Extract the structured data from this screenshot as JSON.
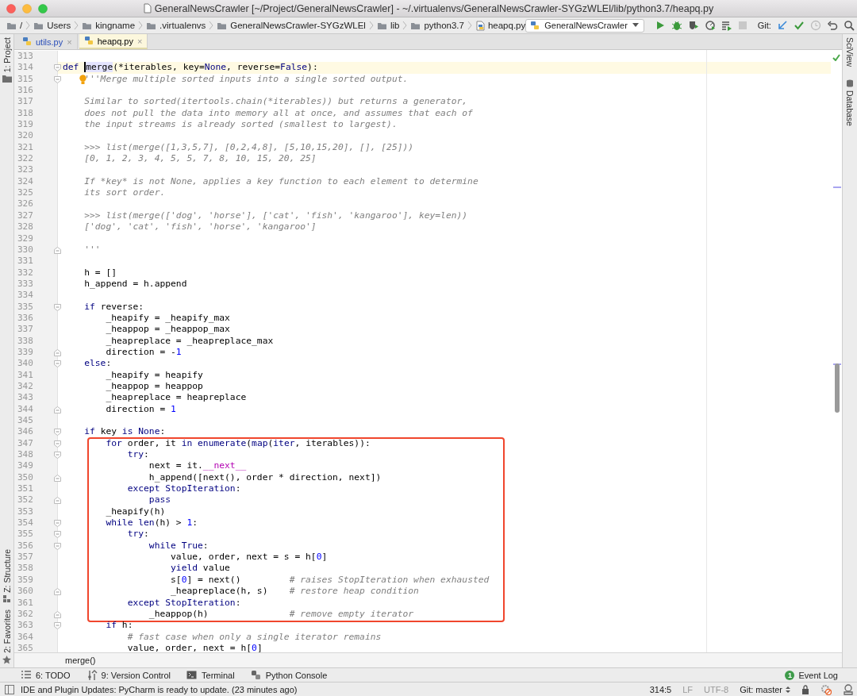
{
  "window": {
    "title": "GeneralNewsCrawler [~/Project/GeneralNewsCrawler] - ~/.virtualenvs/GeneralNewsCrawler-SYGzWLEl/lib/python3.7/heapq.py"
  },
  "navbar": {
    "path": [
      {
        "label": "/",
        "kind": "folder"
      },
      {
        "label": "Users",
        "kind": "folder"
      },
      {
        "label": "kingname",
        "kind": "folder"
      },
      {
        "label": ".virtualenvs",
        "kind": "folder"
      },
      {
        "label": "GeneralNewsCrawler-SYGzWLEl",
        "kind": "folder"
      },
      {
        "label": "lib",
        "kind": "folder"
      },
      {
        "label": "python3.7",
        "kind": "folder"
      },
      {
        "label": "heapq.py",
        "kind": "file"
      }
    ],
    "run_config": "GeneralNewsCrawler",
    "git_label": "Git:"
  },
  "left_tool_strip": {
    "top": [
      {
        "label": "1: Project",
        "kind": "project"
      }
    ],
    "bottom": [
      {
        "label": "Z: Structure",
        "kind": "structure"
      },
      {
        "label": "2: Favorites",
        "kind": "favorites"
      }
    ]
  },
  "right_tool_strip": [
    {
      "label": "SciView",
      "kind": "sciview"
    },
    {
      "label": "Database",
      "kind": "database"
    }
  ],
  "tabs": [
    {
      "label": "utils.py",
      "close": "×",
      "selected": false,
      "kind": "modified"
    },
    {
      "label": "heapq.py",
      "close": "×",
      "selected": true,
      "kind": "unmodified"
    }
  ],
  "editor": {
    "sections": [
      {
        "kind": "plain",
        "lines": [
          {
            "number": "313",
            "current": false,
            "bulb": false
          },
          {
            "number": "314",
            "current": true,
            "bulb": false,
            "fold": {
              "kind": "start"
            },
            "segments": [
              {
                "kind": "kw",
                "text": "def "
              },
              {
                "kind": "caret_word",
                "text": "merge"
              },
              {
                "kind": "plain",
                "text": "(*iterables, key="
              },
              {
                "kind": "kw",
                "text": "None"
              },
              {
                "kind": "plain",
                "text": ", reverse="
              },
              {
                "kind": "kw",
                "text": "False"
              },
              {
                "kind": "plain",
                "text": "):"
              }
            ]
          },
          {
            "number": "315",
            "current": false,
            "bulb": true,
            "fold": {
              "kind": "start"
            },
            "segments": [
              {
                "kind": "doc",
                "text": "    '''Merge multiple sorted inputs into a single sorted output."
              }
            ]
          },
          {
            "number": "316",
            "current": false,
            "bulb": false
          },
          {
            "number": "317",
            "current": false,
            "bulb": false,
            "segments": [
              {
                "kind": "doc",
                "text": "    Similar to sorted(itertools.chain(*iterables)) but returns a generator,"
              }
            ]
          },
          {
            "number": "318",
            "current": false,
            "bulb": false,
            "segments": [
              {
                "kind": "doc",
                "text": "    does not pull the data into memory all at once, and assumes that each of"
              }
            ]
          },
          {
            "number": "319",
            "current": false,
            "bulb": false,
            "segments": [
              {
                "kind": "doc",
                "text": "    the input streams is already sorted (smallest to largest)."
              }
            ]
          },
          {
            "number": "320",
            "current": false,
            "bulb": false
          },
          {
            "number": "321",
            "current": false,
            "bulb": false,
            "segments": [
              {
                "kind": "doc",
                "text": "    >>> list(merge([1,3,5,7], [0,2,4,8], [5,10,15,20], [], [25]))"
              }
            ]
          },
          {
            "number": "322",
            "current": false,
            "bulb": false,
            "segments": [
              {
                "kind": "doc",
                "text": "    [0, 1, 2, 3, 4, 5, 5, 7, 8, 10, 15, 20, 25]"
              }
            ]
          },
          {
            "number": "323",
            "current": false,
            "bulb": false
          },
          {
            "number": "324",
            "current": false,
            "bulb": false,
            "segments": [
              {
                "kind": "doc",
                "text": "    If *key* is not None, applies a key function to each element to determine"
              }
            ]
          },
          {
            "number": "325",
            "current": false,
            "bulb": false,
            "segments": [
              {
                "kind": "doc",
                "text": "    its sort order."
              }
            ]
          },
          {
            "number": "326",
            "current": false,
            "bulb": false
          },
          {
            "number": "327",
            "current": false,
            "bulb": false,
            "segments": [
              {
                "kind": "doc",
                "text": "    >>> list(merge(['dog', 'horse'], ['cat', 'fish', 'kangaroo'], key=len))"
              }
            ]
          },
          {
            "number": "328",
            "current": false,
            "bulb": false,
            "segments": [
              {
                "kind": "doc",
                "text": "    ['dog', 'cat', 'fish', 'horse', 'kangaroo']"
              }
            ]
          },
          {
            "number": "329",
            "current": false,
            "bulb": false
          },
          {
            "number": "330",
            "current": false,
            "bulb": false,
            "fold": {
              "kind": "end"
            },
            "segments": [
              {
                "kind": "doc",
                "text": "    '''"
              }
            ]
          },
          {
            "number": "331",
            "current": false,
            "bulb": false
          },
          {
            "number": "332",
            "current": false,
            "bulb": false,
            "segments": [
              {
                "kind": "plain",
                "text": "    h = []"
              }
            ]
          },
          {
            "number": "333",
            "current": false,
            "bulb": false,
            "segments": [
              {
                "kind": "plain",
                "text": "    h_append = h.append"
              }
            ]
          },
          {
            "number": "334",
            "current": false,
            "bulb": false
          },
          {
            "number": "335",
            "current": false,
            "bulb": false,
            "fold": {
              "kind": "start"
            },
            "segments": [
              {
                "kind": "kw",
                "text": "    if"
              },
              {
                "kind": "plain",
                "text": " reverse:"
              }
            ]
          },
          {
            "number": "336",
            "current": false,
            "bulb": false,
            "segments": [
              {
                "kind": "plain",
                "text": "        _heapify = _heapify_max"
              }
            ]
          },
          {
            "number": "337",
            "current": false,
            "bulb": false,
            "segments": [
              {
                "kind": "plain",
                "text": "        _heappop = _heappop_max"
              }
            ]
          },
          {
            "number": "338",
            "current": false,
            "bulb": false,
            "segments": [
              {
                "kind": "plain",
                "text": "        _heapreplace = _heapreplace_max"
              }
            ]
          },
          {
            "number": "339",
            "current": false,
            "bulb": false,
            "fold": {
              "kind": "end"
            },
            "segments": [
              {
                "kind": "plain",
                "text": "        direction = -"
              },
              {
                "kind": "num",
                "text": "1"
              }
            ]
          },
          {
            "number": "340",
            "current": false,
            "bulb": false,
            "fold": {
              "kind": "start"
            },
            "segments": [
              {
                "kind": "kw",
                "text": "    else"
              },
              {
                "kind": "plain",
                "text": ":"
              }
            ]
          },
          {
            "number": "341",
            "current": false,
            "bulb": false,
            "segments": [
              {
                "kind": "plain",
                "text": "        _heapify = heapify"
              }
            ]
          },
          {
            "number": "342",
            "current": false,
            "bulb": false,
            "segments": [
              {
                "kind": "plain",
                "text": "        _heappop = heappop"
              }
            ]
          },
          {
            "number": "343",
            "current": false,
            "bulb": false,
            "segments": [
              {
                "kind": "plain",
                "text": "        _heapreplace = heapreplace"
              }
            ]
          },
          {
            "number": "344",
            "current": false,
            "bulb": false,
            "fold": {
              "kind": "end"
            },
            "segments": [
              {
                "kind": "plain",
                "text": "        direction = "
              },
              {
                "kind": "num",
                "text": "1"
              }
            ]
          },
          {
            "number": "345",
            "current": false,
            "bulb": false
          },
          {
            "number": "346",
            "current": false,
            "bulb": false,
            "fold": {
              "kind": "start"
            },
            "segments": [
              {
                "kind": "kw",
                "text": "    if"
              },
              {
                "kind": "plain",
                "text": " key "
              },
              {
                "kind": "kw",
                "text": "is None"
              },
              {
                "kind": "plain",
                "text": ":"
              }
            ]
          }
        ]
      },
      {
        "kind": "boxed",
        "lines": [
          {
            "number": "347",
            "current": false,
            "bulb": false,
            "fold": {
              "kind": "start"
            },
            "segments": [
              {
                "kind": "kw",
                "text": "        for"
              },
              {
                "kind": "plain",
                "text": " order, it "
              },
              {
                "kind": "kw",
                "text": "in enumerate"
              },
              {
                "kind": "plain",
                "text": "("
              },
              {
                "kind": "kw",
                "text": "map"
              },
              {
                "kind": "plain",
                "text": "("
              },
              {
                "kind": "kw",
                "text": "iter"
              },
              {
                "kind": "plain",
                "text": ", iterables)):"
              }
            ]
          },
          {
            "number": "348",
            "current": false,
            "bulb": false,
            "fold": {
              "kind": "start"
            },
            "segments": [
              {
                "kind": "kw",
                "text": "            try"
              },
              {
                "kind": "plain",
                "text": ":"
              }
            ]
          },
          {
            "number": "349",
            "current": false,
            "bulb": false,
            "segments": [
              {
                "kind": "plain",
                "text": "                next = it."
              },
              {
                "kind": "magic",
                "text": "__next__"
              }
            ]
          },
          {
            "number": "350",
            "current": false,
            "bulb": false,
            "fold": {
              "kind": "end"
            },
            "segments": [
              {
                "kind": "plain",
                "text": "                h_append([next(), order * direction, next])"
              }
            ]
          },
          {
            "number": "351",
            "current": false,
            "bulb": false,
            "segments": [
              {
                "kind": "kw",
                "text": "            except StopIteration"
              },
              {
                "kind": "plain",
                "text": ":"
              }
            ]
          },
          {
            "number": "352",
            "current": false,
            "bulb": false,
            "fold": {
              "kind": "end"
            },
            "segments": [
              {
                "kind": "kw",
                "text": "                pass"
              }
            ]
          },
          {
            "number": "353",
            "current": false,
            "bulb": false,
            "segments": [
              {
                "kind": "plain",
                "text": "        _heapify(h)"
              }
            ]
          },
          {
            "number": "354",
            "current": false,
            "bulb": false,
            "fold": {
              "kind": "start"
            },
            "segments": [
              {
                "kind": "kw",
                "text": "        while len"
              },
              {
                "kind": "plain",
                "text": "(h) > "
              },
              {
                "kind": "num",
                "text": "1"
              },
              {
                "kind": "plain",
                "text": ":"
              }
            ]
          },
          {
            "number": "355",
            "current": false,
            "bulb": false,
            "fold": {
              "kind": "start"
            },
            "segments": [
              {
                "kind": "kw",
                "text": "            try"
              },
              {
                "kind": "plain",
                "text": ":"
              }
            ]
          },
          {
            "number": "356",
            "current": false,
            "bulb": false,
            "fold": {
              "kind": "start"
            },
            "segments": [
              {
                "kind": "kw",
                "text": "                while True"
              },
              {
                "kind": "plain",
                "text": ":"
              }
            ]
          },
          {
            "number": "357",
            "current": false,
            "bulb": false,
            "segments": [
              {
                "kind": "plain",
                "text": "                    value, order, next = s = h["
              },
              {
                "kind": "num",
                "text": "0"
              },
              {
                "kind": "plain",
                "text": "]"
              }
            ]
          },
          {
            "number": "358",
            "current": false,
            "bulb": false,
            "segments": [
              {
                "kind": "kw",
                "text": "                    yield"
              },
              {
                "kind": "plain",
                "text": " value"
              }
            ]
          },
          {
            "number": "359",
            "current": false,
            "bulb": false,
            "segments": [
              {
                "kind": "plain",
                "text": "                    s["
              },
              {
                "kind": "num",
                "text": "0"
              },
              {
                "kind": "plain",
                "text": "] = next()         "
              },
              {
                "kind": "comment",
                "text": "# raises StopIteration when exhausted"
              }
            ]
          },
          {
            "number": "360",
            "current": false,
            "bulb": false,
            "fold": {
              "kind": "end"
            },
            "segments": [
              {
                "kind": "plain",
                "text": "                    _heapreplace(h, s)    "
              },
              {
                "kind": "comment",
                "text": "# restore heap condition"
              }
            ]
          },
          {
            "number": "361",
            "current": false,
            "bulb": false,
            "segments": [
              {
                "kind": "kw",
                "text": "            except StopIteration"
              },
              {
                "kind": "plain",
                "text": ":"
              }
            ]
          },
          {
            "number": "362",
            "current": false,
            "bulb": false,
            "fold": {
              "kind": "end"
            },
            "segments": [
              {
                "kind": "plain",
                "text": "                _heappop(h)               "
              },
              {
                "kind": "comment",
                "text": "# remove empty iterator"
              }
            ]
          }
        ]
      },
      {
        "kind": "plain",
        "lines": [
          {
            "number": "363",
            "current": false,
            "bulb": false,
            "fold": {
              "kind": "start"
            },
            "segments": [
              {
                "kind": "kw",
                "text": "        if"
              },
              {
                "kind": "plain",
                "text": " h:"
              }
            ]
          },
          {
            "number": "364",
            "current": false,
            "bulb": false,
            "segments": [
              {
                "kind": "comment",
                "text": "            # fast case when only a single iterator remains"
              }
            ]
          },
          {
            "number": "365",
            "current": false,
            "bulb": false,
            "segments": [
              {
                "kind": "plain",
                "text": "            value, order, next = h["
              },
              {
                "kind": "num",
                "text": "0"
              },
              {
                "kind": "plain",
                "text": "]"
              }
            ]
          }
        ]
      }
    ]
  },
  "breadcrumb": "merge()",
  "tool_windows": [
    {
      "label": "6: TODO",
      "kind": "todo"
    },
    {
      "label": "9: Version Control",
      "kind": "vcs"
    },
    {
      "label": "Terminal",
      "kind": "terminal"
    },
    {
      "label": "Python Console",
      "kind": "console"
    }
  ],
  "event_log": {
    "label": "Event Log",
    "badge": "1"
  },
  "status_bar": {
    "message": "IDE and Plugin Updates: PyCharm is ready to update. (23 minutes ago)",
    "position": "314:5",
    "line_separator": "LF",
    "encoding": "UTF-8",
    "branch": "Git: master"
  }
}
